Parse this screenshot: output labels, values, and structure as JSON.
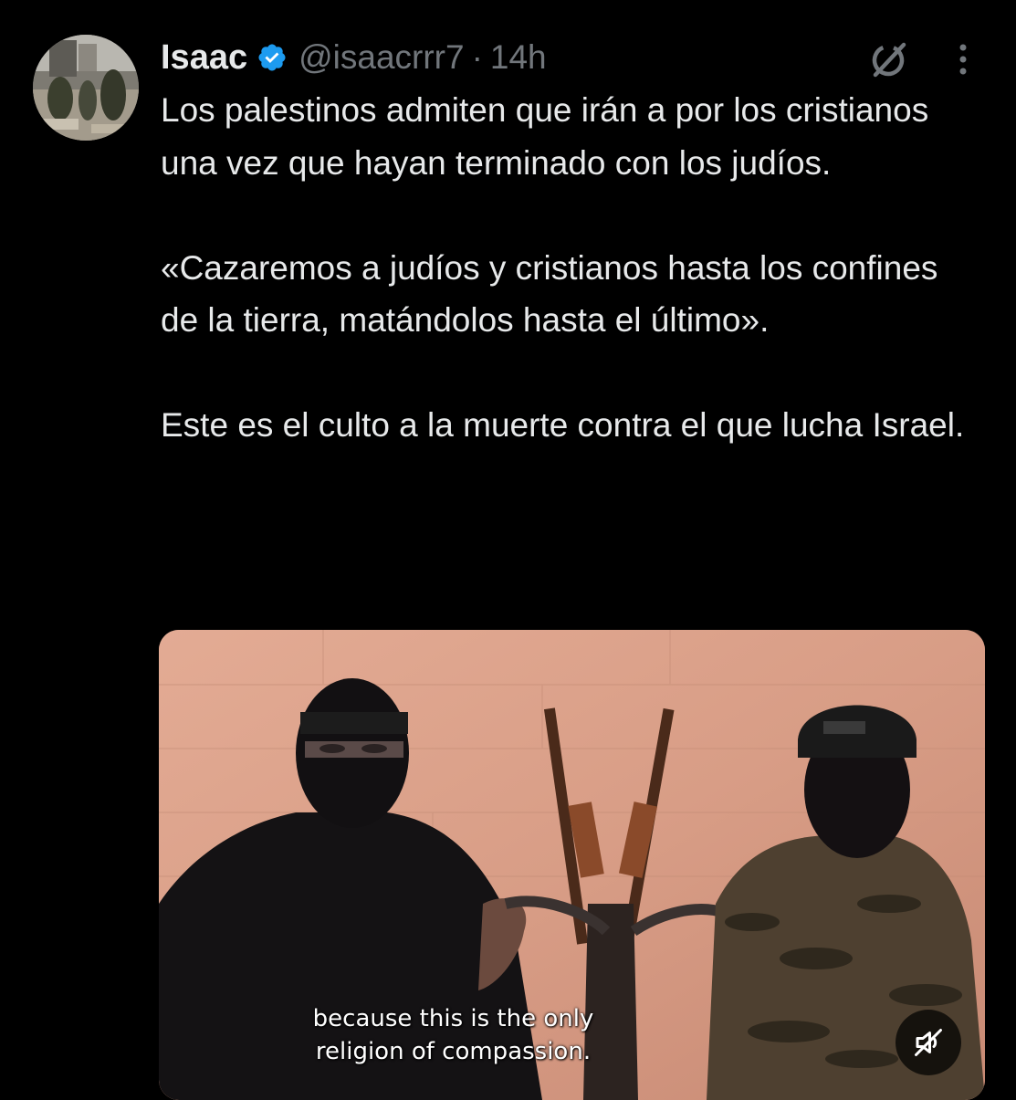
{
  "author": {
    "name": "Isaac",
    "handle": "@isaacrrr7",
    "separator": "·",
    "time": "14h",
    "verified": true
  },
  "tweet": {
    "paragraphs": [
      "Los palestinos admiten que irán a por los cristianos una vez que hayan terminado con los judíos.",
      "«Cazaremos a judíos y cristianos hasta los confines de la tierra, matándolos hasta el último».",
      "Este es el culto a la muerte contra el que lucha Israel."
    ]
  },
  "media": {
    "type": "video",
    "subtitle_line1": "because this is the only",
    "subtitle_line2": "religion of compassion.",
    "muted": true
  },
  "icons": {
    "verified": "verified-badge-icon",
    "grok": "grok-icon",
    "more": "more-options-icon",
    "mute": "muted-speaker-icon"
  },
  "colors": {
    "background": "#000000",
    "text": "#e7e9ea",
    "secondary": "#71767b",
    "verified": "#1d9bf0"
  }
}
